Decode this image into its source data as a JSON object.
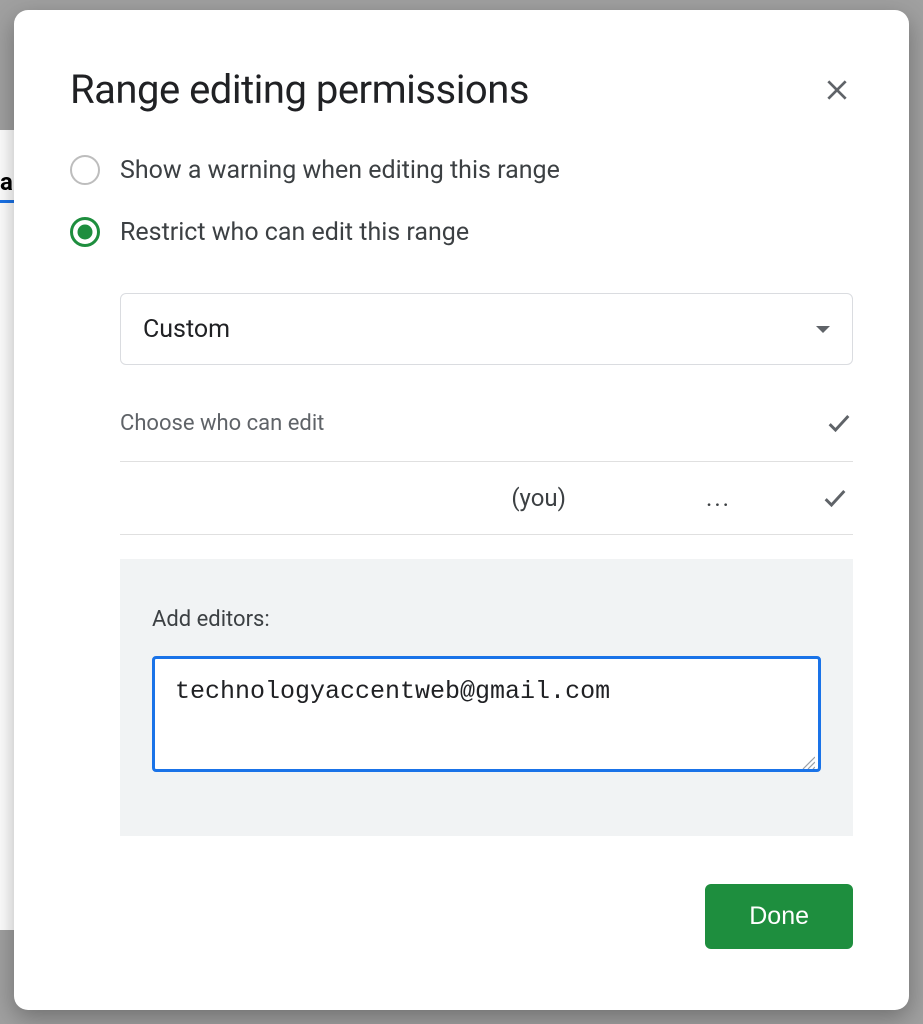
{
  "dialog": {
    "title": "Range editing permissions",
    "option_warning_label": "Show a warning when editing this range",
    "option_restrict_label": "Restrict who can edit this range",
    "selected_option": "restrict",
    "dropdown_value": "Custom",
    "choose_label": "Choose who can edit",
    "user_row": {
      "you_label": "(you)",
      "dots": "..."
    },
    "add_editors_label": "Add editors:",
    "add_editors_value": "technologyaccentweb@gmail.com",
    "done_label": "Done"
  },
  "bg_letter": "a"
}
